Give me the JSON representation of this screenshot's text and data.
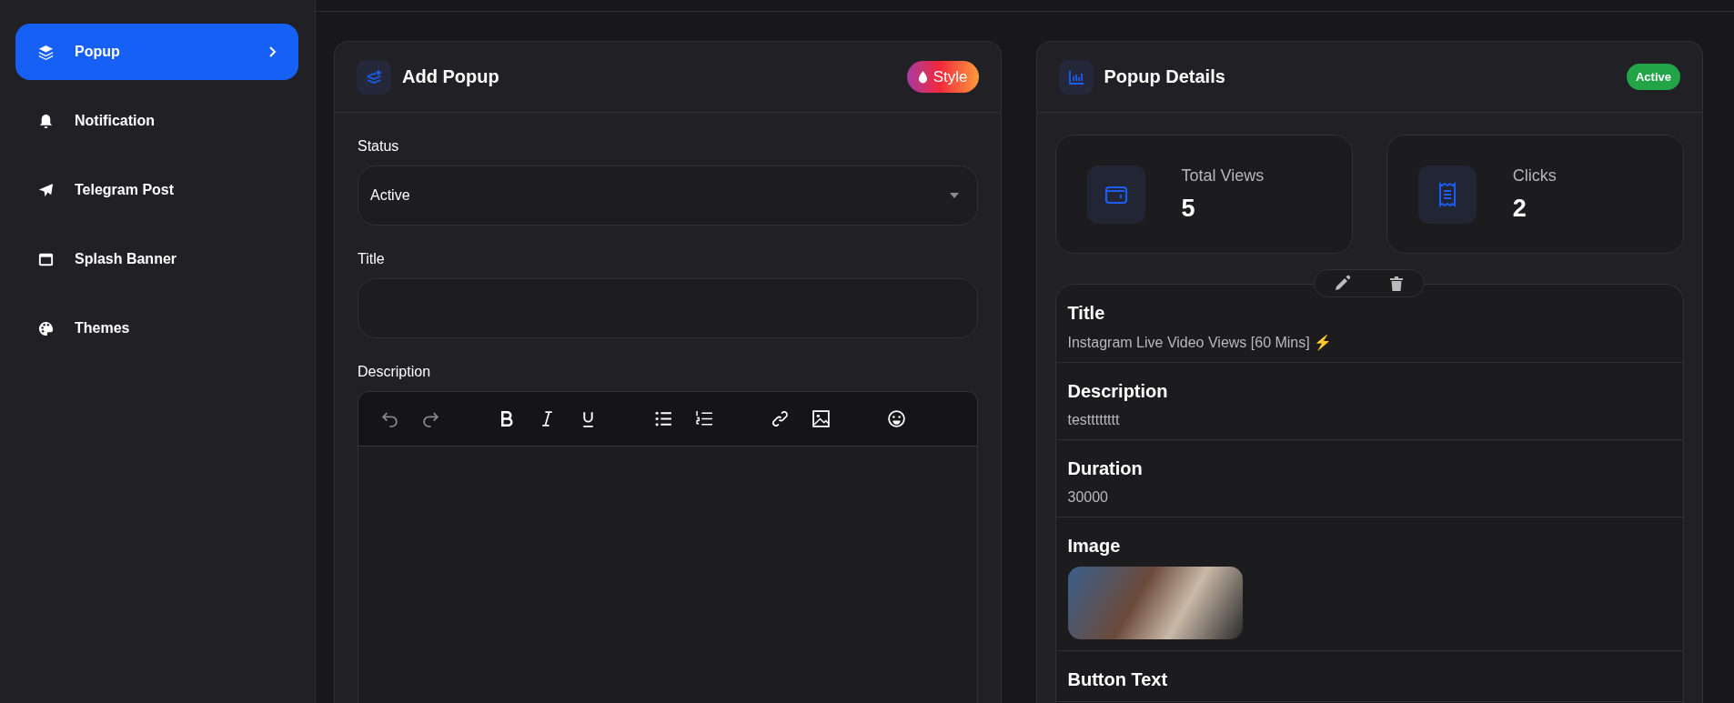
{
  "sidebar": {
    "items": [
      {
        "label": "Popup",
        "selected": true
      },
      {
        "label": "Notification",
        "selected": false
      },
      {
        "label": "Telegram Post",
        "selected": false
      },
      {
        "label": "Splash Banner",
        "selected": false
      },
      {
        "label": "Themes",
        "selected": false
      }
    ]
  },
  "add_popup": {
    "title": "Add Popup",
    "style_button": "Style",
    "fields": [
      {
        "kind": "select",
        "label": "Status",
        "value": "Active"
      },
      {
        "kind": "text",
        "label": "Title"
      },
      {
        "kind": "editor",
        "label": "Description"
      }
    ]
  },
  "details": {
    "title": "Popup Details",
    "status_badge": "Active",
    "stats": [
      {
        "label": "Total Views",
        "value": "5"
      },
      {
        "label": "Clicks",
        "value": "2"
      }
    ],
    "rows": [
      {
        "kind": "text",
        "label": "Title",
        "value": "Instagram Live Video Views [60 Mins] ⚡"
      },
      {
        "kind": "text",
        "label": "Description",
        "value": "testttttttt"
      },
      {
        "kind": "text",
        "label": "Duration",
        "value": "30000"
      },
      {
        "kind": "image",
        "label": "Image"
      },
      {
        "kind": "text",
        "label": "Button Text"
      }
    ]
  }
}
